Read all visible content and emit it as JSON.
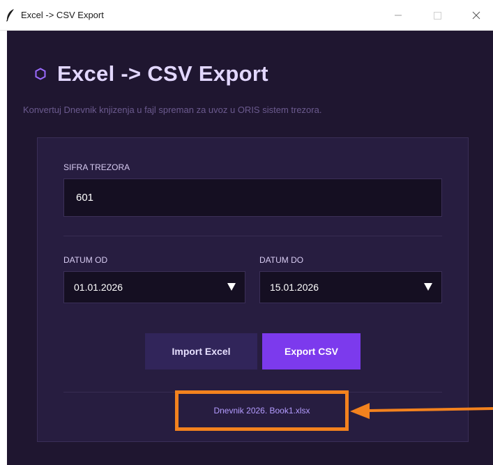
{
  "window": {
    "title": "Excel -> CSV Export",
    "controls": [
      "minimize",
      "maximize",
      "close"
    ]
  },
  "header": {
    "title": "Excel -> CSV Export",
    "subtitle": "Konvertuj Dnevnik knjizenja u fajl spreman za uvoz u ORIS sistem trezora."
  },
  "form": {
    "sifra_label": "SIFRA TREZORA",
    "sifra_value": "601",
    "datum_od_label": "DATUM OD",
    "datum_od_value": "01.01.2026",
    "datum_do_label": "DATUM DO",
    "datum_do_value": "15.01.2026"
  },
  "actions": {
    "import_label": "Import Excel",
    "export_label": "Export CSV"
  },
  "status": {
    "file_name": "Dnevnik 2026. Book1.xlsx"
  },
  "colors": {
    "background": "#1f1630",
    "card": "#271d40",
    "accent": "#7c3aed",
    "highlight": "#f3821e"
  },
  "icons": {
    "window_icon": "feather-icon",
    "heading_icon": "hexagon-icon",
    "dropdown": "caret-down-icon",
    "annotation": "arrow-left-icon"
  }
}
